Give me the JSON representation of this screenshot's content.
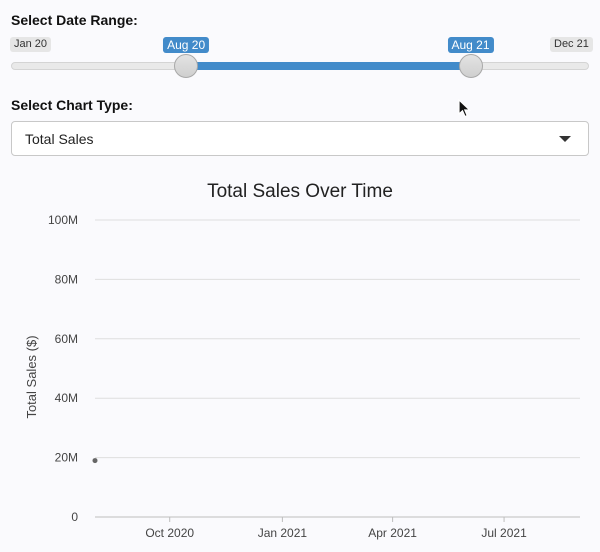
{
  "date_range": {
    "label": "Select Date Range:",
    "min_label": "Jan 20",
    "max_label": "Dec 21",
    "from_label": "Aug 20",
    "to_label": "Aug 21",
    "from_fraction": 0.303,
    "to_fraction": 0.795,
    "accent": "#428bca"
  },
  "chart_type": {
    "label": "Select Chart Type:",
    "selected": "Total Sales"
  },
  "chart_data": {
    "type": "line",
    "title": "Total Sales Over Time",
    "xlabel": "",
    "ylabel": "Total Sales ($)",
    "x_ticks": [
      "Oct 2020",
      "Jan 2021",
      "Apr 2021",
      "Jul 2021"
    ],
    "x_tick_dates": [
      "2020-10-01",
      "2021-01-01",
      "2021-04-01",
      "2021-07-01"
    ],
    "xlim": [
      "2020-08-01",
      "2021-09-01"
    ],
    "y_ticks": [
      "0",
      "20M",
      "40M",
      "60M",
      "80M",
      "100M"
    ],
    "y_tick_values": [
      0,
      20000000,
      40000000,
      60000000,
      80000000,
      100000000
    ],
    "ylim": [
      0,
      100000000
    ],
    "grid": true,
    "series": [
      {
        "x": [
          "2020-08-01"
        ],
        "values": [
          19000000
        ]
      }
    ]
  }
}
